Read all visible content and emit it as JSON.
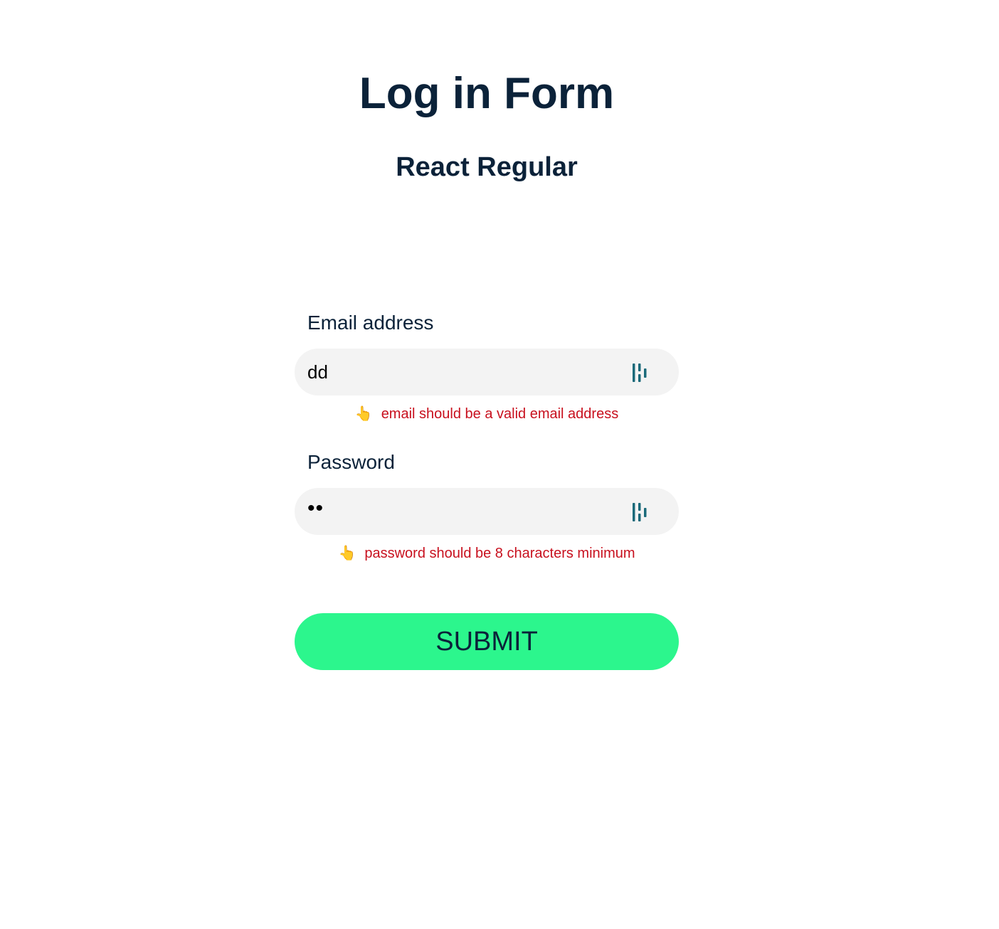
{
  "header": {
    "title": "Log in Form",
    "subtitle": "React Regular"
  },
  "form": {
    "email": {
      "label": "Email address",
      "value": "dd",
      "error": "email should be a valid email address",
      "icon": "password-manager-icon"
    },
    "password": {
      "label": "Password",
      "value": "••",
      "error": "password should be 8 characters minimum",
      "icon": "password-manager-icon"
    },
    "error_icon": "👆",
    "submit_label": "SUBMIT"
  },
  "colors": {
    "text": "#0b2239",
    "error": "#c8101e",
    "input_bg": "#f3f3f3",
    "submit_bg": "#2cf68d",
    "icon": "#1b6a7a"
  }
}
